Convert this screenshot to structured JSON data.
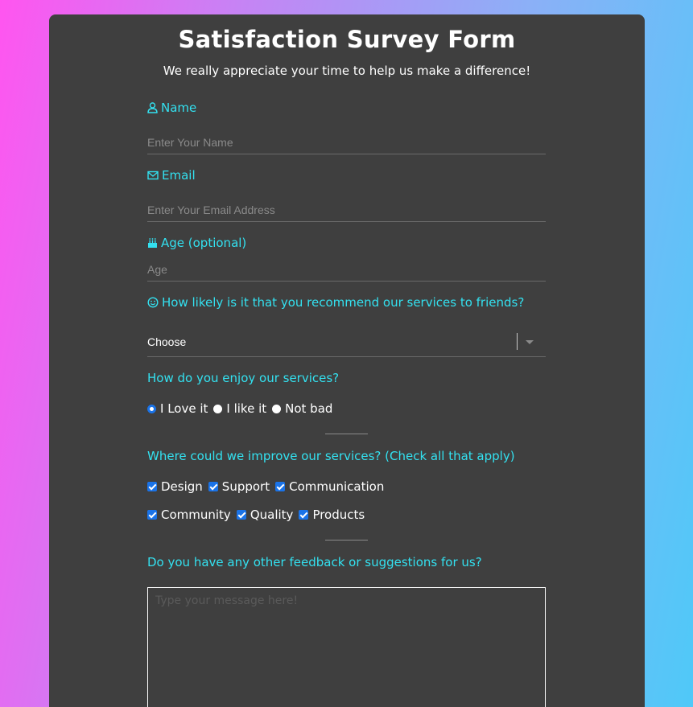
{
  "form": {
    "title": "Satisfaction Survey Form",
    "subtitle": "We really appreciate your time to help us make a difference!"
  },
  "name_field": {
    "label": "Name",
    "placeholder": "Enter Your Name",
    "icon": "user-icon"
  },
  "email_field": {
    "label": "Email",
    "placeholder": "Enter Your Email Address",
    "icon": "envelope-icon"
  },
  "age_field": {
    "label": "Age (optional)",
    "placeholder": "Age",
    "icon": "birthday-cake-icon"
  },
  "recommend": {
    "label": "How likely is it that you recommend our services to friends?",
    "icon": "smile-icon",
    "selected": "Choose"
  },
  "enjoy": {
    "label": "How do you enjoy our services?",
    "options": [
      {
        "label": "I Love it",
        "checked": true
      },
      {
        "label": "I like it",
        "checked": false
      },
      {
        "label": "Not bad",
        "checked": false
      }
    ]
  },
  "improve": {
    "label": "Where could we improve our services? (Check all that apply)",
    "options": [
      {
        "label": "Design",
        "checked": true
      },
      {
        "label": "Support",
        "checked": true
      },
      {
        "label": "Communication",
        "checked": true
      },
      {
        "label": "Community",
        "checked": true
      },
      {
        "label": "Quality",
        "checked": true
      },
      {
        "label": "Products",
        "checked": true
      }
    ]
  },
  "feedback": {
    "label": "Do you have any other feedback or suggestions for us?",
    "placeholder": "Type your message here!"
  },
  "colors": {
    "label_accent": "#33e1f0",
    "card_background": "#3f3f3f",
    "control_blue": "#1a73e8"
  }
}
